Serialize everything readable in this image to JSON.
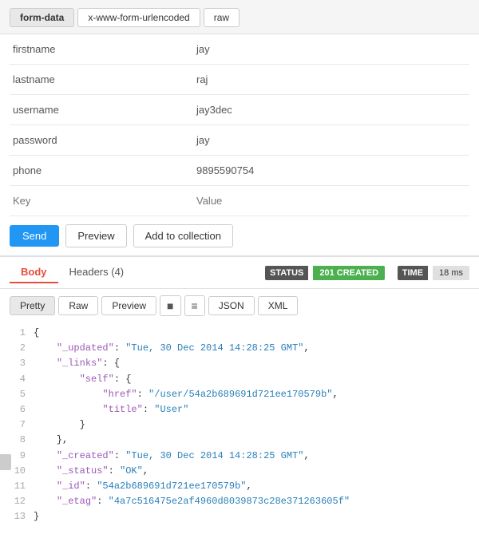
{
  "tabs": {
    "items": [
      {
        "label": "form-data",
        "active": true
      },
      {
        "label": "x-www-form-urlencoded",
        "active": false
      },
      {
        "label": "raw",
        "active": false
      }
    ]
  },
  "form_fields": [
    {
      "key": "firstname",
      "value": "jay"
    },
    {
      "key": "lastname",
      "value": "raj"
    },
    {
      "key": "username",
      "value": "jay3dec"
    },
    {
      "key": "password",
      "value": "jay"
    },
    {
      "key": "phone",
      "value": "9895590754"
    }
  ],
  "placeholder": {
    "key": "Key",
    "value": "Value"
  },
  "actions": {
    "send": "Send",
    "preview": "Preview",
    "add_collection": "Add to collection"
  },
  "response": {
    "body_tab": "Body",
    "headers_tab": "Headers (4)",
    "status_label": "STATUS",
    "status_value": "201 CREATED",
    "time_label": "TIME",
    "time_value": "18 ms"
  },
  "format_buttons": [
    {
      "label": "Pretty",
      "active": true
    },
    {
      "label": "Raw",
      "active": false
    },
    {
      "label": "Preview",
      "active": false
    }
  ],
  "format_types": [
    {
      "label": "JSON"
    },
    {
      "label": "XML"
    }
  ],
  "code_lines": [
    {
      "num": 1,
      "content": "{"
    },
    {
      "num": 2,
      "content": "    \"_updated\": \"Tue, 30 Dec 2014 14:28:25 GMT\","
    },
    {
      "num": 3,
      "content": "    \"_links\": {"
    },
    {
      "num": 4,
      "content": "        \"self\": {"
    },
    {
      "num": 5,
      "content": "            \"href\": \"/user/54a2b689691d721ee170579b\","
    },
    {
      "num": 6,
      "content": "            \"title\": \"User\""
    },
    {
      "num": 7,
      "content": "        }"
    },
    {
      "num": 8,
      "content": "    },"
    },
    {
      "num": 9,
      "content": "    \"_created\": \"Tue, 30 Dec 2014 14:28:25 GMT\","
    },
    {
      "num": 10,
      "content": "    \"_status\": \"OK\","
    },
    {
      "num": 11,
      "content": "    \"_id\": \"54a2b689691d721ee170579b\","
    },
    {
      "num": 12,
      "content": "    \"_etag\": \"4a7c516475e2af4960d8039873c28e371263605f\""
    },
    {
      "num": 13,
      "content": "}"
    }
  ]
}
